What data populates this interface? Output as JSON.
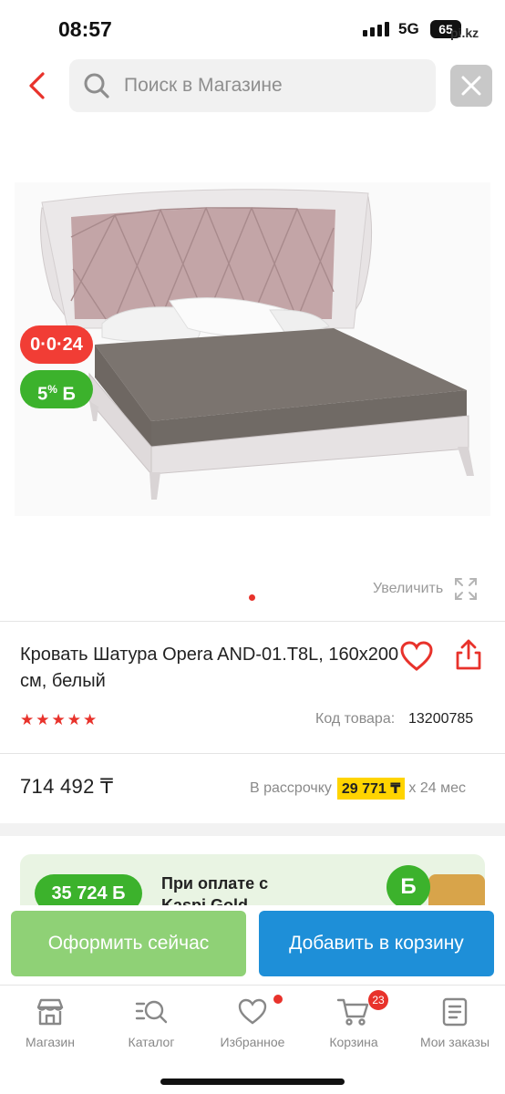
{
  "status": {
    "time": "08:57",
    "network": "5G",
    "battery": "65",
    "watermark": "pi.kz"
  },
  "search": {
    "placeholder": "Поиск в Магазине"
  },
  "badges": {
    "installment": "0·0·24",
    "bonus_value": "5",
    "bonus_suffix": "%",
    "bonus_letter": "Б"
  },
  "gallery": {
    "zoom_label": "Увеличить",
    "images_count": 1,
    "active_index": 0
  },
  "product": {
    "title": "Кровать Шатура Opera AND-01.T8L, 160x200 см, белый",
    "rating": 5,
    "sku_label": "Код товара:",
    "sku_value": "13200785",
    "price": "714 492 ₸",
    "installment_label": "В рассрочку",
    "installment_amount": "29 771 ₸",
    "installment_term": "x 24 мес"
  },
  "promo": {
    "bonus_amount": "35 724 Б",
    "text_line1": "При оплате с",
    "text_line2": "Kaspi Gold",
    "coin_letter": "Б"
  },
  "actions": {
    "buy_now": "Оформить сейчас",
    "add_to_cart": "Добавить в корзину"
  },
  "tabs": [
    {
      "label": "Магазин",
      "icon": "store-icon"
    },
    {
      "label": "Каталог",
      "icon": "catalog-search-icon"
    },
    {
      "label": "Избранное",
      "icon": "heart-icon",
      "dot": true
    },
    {
      "label": "Корзина",
      "icon": "cart-icon",
      "badge": "23"
    },
    {
      "label": "Мои заказы",
      "icon": "orders-icon"
    }
  ],
  "colors": {
    "accent_red": "#e8322b",
    "green": "#3cb22c",
    "blue": "#1e8fd8",
    "yellow": "#ffd400"
  }
}
